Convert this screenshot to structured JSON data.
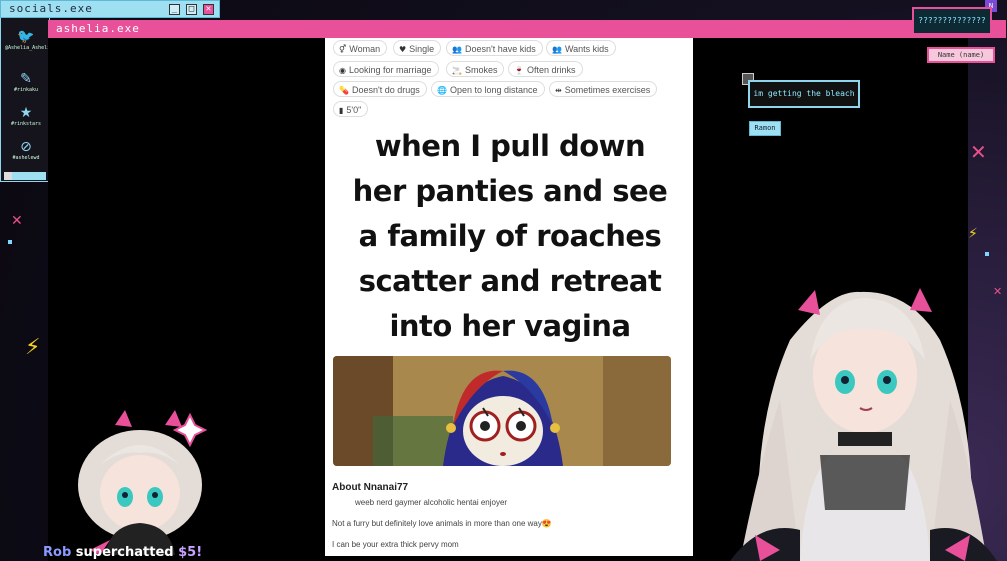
{
  "socials_window": {
    "title": "socials.exe",
    "buttons": [
      "_",
      "□",
      "✕"
    ],
    "items": [
      {
        "icon": "twitter-icon",
        "glyph": "🐦",
        "label": "@Ashelia_Ashelia"
      },
      {
        "icon": "paintbrush-icon",
        "glyph": "✎",
        "label": "#rinkaku"
      },
      {
        "icon": "star-icon",
        "glyph": "★",
        "label": "#rinkstars"
      },
      {
        "icon": "no-entry-icon",
        "glyph": "⊘",
        "label": "#ashelewd"
      }
    ]
  },
  "main_window": {
    "title": "ashelia.exe"
  },
  "profile": {
    "tags_row1": [
      {
        "icon": "gender-icon",
        "glyph": "⚥",
        "label": "Woman"
      },
      {
        "icon": "heart-icon",
        "glyph": "♥",
        "label": "Single"
      },
      {
        "icon": "people-icon",
        "glyph": "👥",
        "label": "Doesn't have kids"
      },
      {
        "icon": "people-icon",
        "glyph": "👥",
        "label": "Wants kids"
      }
    ],
    "tags_row2": [
      {
        "icon": "eye-icon",
        "glyph": "◉",
        "label": "Looking for marriage"
      },
      {
        "icon": "smoking-icon",
        "glyph": "🚬",
        "label": "Smokes"
      },
      {
        "icon": "drink-icon",
        "glyph": "🍷",
        "label": "Often drinks"
      }
    ],
    "tags_row3": [
      {
        "icon": "pill-icon",
        "glyph": "💊",
        "label": "Doesn't do drugs"
      },
      {
        "icon": "globe-icon",
        "glyph": "🌐",
        "label": "Open to long distance"
      },
      {
        "icon": "dumbbell-icon",
        "glyph": "⇹",
        "label": "Sometimes exercises"
      }
    ],
    "tags_row4": [
      {
        "icon": "ruler-icon",
        "glyph": "▮",
        "label": "5'0\""
      }
    ],
    "meme_lines": [
      "when I pull down",
      "her panties and see",
      "a family of roaches",
      "scatter and retreat",
      "into her vagina"
    ],
    "about_heading": "About Nnanai77",
    "about_lines": [
      "weeb nerd gaymer alcoholic hentai enjoyer",
      "Not a furry but definitely love animals in more than one way😍",
      "I can be your extra thick pervy mom"
    ]
  },
  "chat": {
    "bubble1_text": "??????????????",
    "bubble1_name": "Name (name)",
    "bubble1_badge": "N",
    "bubble2_text": "im getting the bleach",
    "bubble2_name": "Ramon"
  },
  "superchat": {
    "name": "Rob",
    "text": "superchatted",
    "amount": "$5!"
  },
  "colors": {
    "pink_accent": "#e8509a",
    "cyan_accent": "#9fdff2"
  }
}
